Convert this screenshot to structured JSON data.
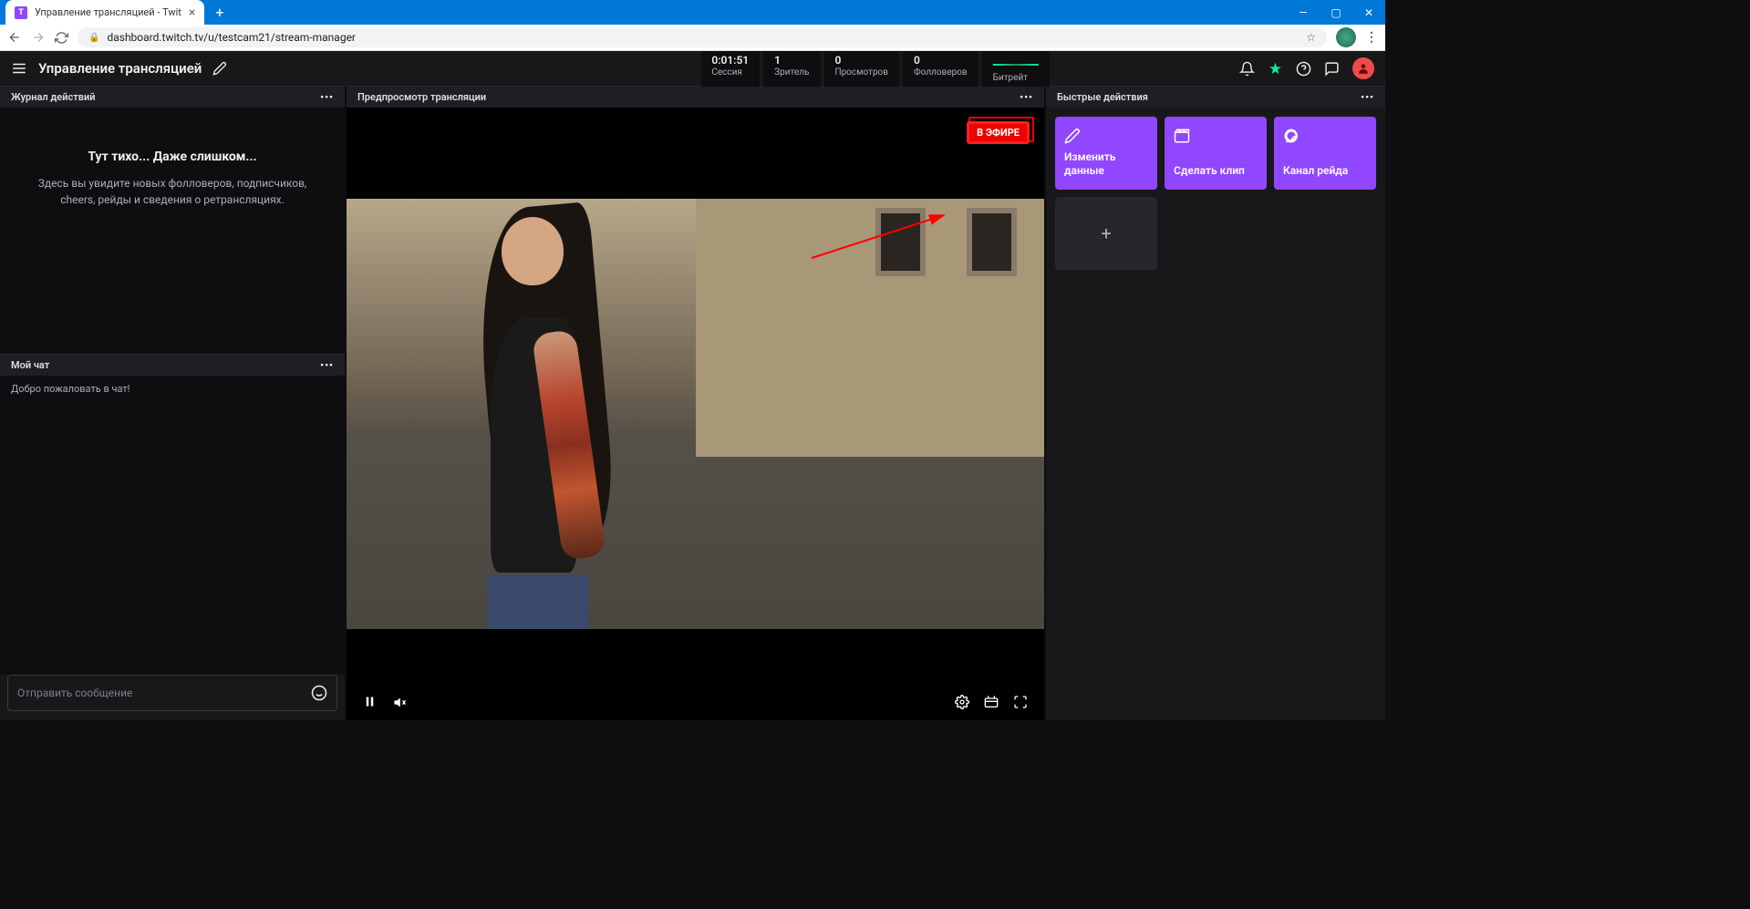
{
  "browser": {
    "tab_title": "Управление трансляцией - Twit",
    "url": "dashboard.twitch.tv/u/testcam21/stream-manager",
    "new_tab": "+"
  },
  "header": {
    "title": "Управление трансляцией"
  },
  "stats": {
    "session": {
      "value": "0:01:51",
      "label": "Сессия"
    },
    "viewers": {
      "value": "1",
      "label": "Зритель"
    },
    "views": {
      "value": "0",
      "label": "Просмотров"
    },
    "followers": {
      "value": "0",
      "label": "Фолловеров"
    },
    "bitrate": {
      "label": "Битрейт"
    }
  },
  "panels": {
    "activity": {
      "title": "Журнал действий",
      "empty_title": "Тут тихо... Даже слишком...",
      "empty_desc": "Здесь вы увидите новых фолловеров, подписчиков, cheers, рейды и сведения о ретрансляциях."
    },
    "chat": {
      "title": "Мой чат",
      "welcome": "Добро пожаловать в чат!",
      "placeholder": "Отправить сообщение"
    },
    "preview": {
      "title": "Предпросмотр трансляции",
      "live_badge": "В ЭФИРЕ"
    },
    "quick_actions": {
      "title": "Быстрые действия",
      "cards": [
        {
          "label": "Изменить данные"
        },
        {
          "label": "Сделать клип"
        },
        {
          "label": "Канал рейда"
        }
      ],
      "add": "+"
    }
  }
}
